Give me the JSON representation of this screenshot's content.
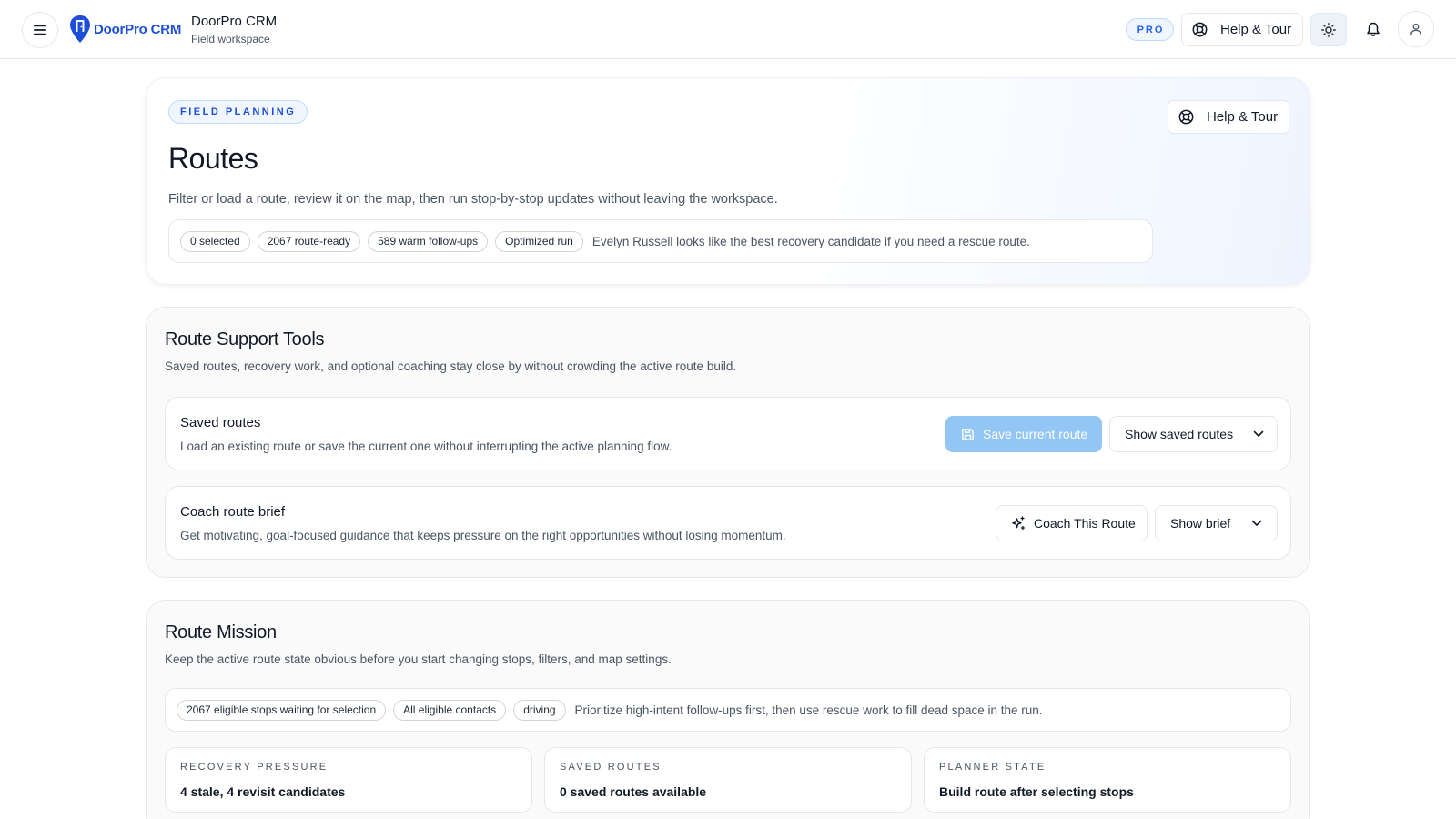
{
  "app": {
    "logo_text": "DoorPro CRM",
    "title": "DoorPro CRM",
    "subtitle": "Field workspace"
  },
  "topbar": {
    "plan_badge": "PRO",
    "help_label": "Help & Tour",
    "icons": [
      "menu-icon",
      "sun-icon",
      "bell-icon",
      "user-icon",
      "lifebuoy-icon"
    ]
  },
  "hero": {
    "eyebrow": "FIELD PLANNING",
    "title": "Routes",
    "description": "Filter or load a route, review it on the map, then run stop-by-stop updates without leaving the workspace.",
    "help_label": "Help & Tour",
    "chips": [
      "0 selected",
      "2067 route-ready",
      "589 warm follow-ups",
      "Optimized run"
    ],
    "insight": "Evelyn Russell looks like the best recovery candidate if you need a rescue route."
  },
  "support": {
    "title": "Route Support Tools",
    "description": "Saved routes, recovery work, and optional coaching stay close by without crowding the active route build.",
    "saved": {
      "title": "Saved routes",
      "description": "Load an existing route or save the current one without interrupting the active planning flow.",
      "save_label": "Save current route",
      "show_label": "Show saved routes"
    },
    "coach": {
      "title": "Coach route brief",
      "description": "Get motivating, goal-focused guidance that keeps pressure on the right opportunities without losing momentum.",
      "coach_label": "Coach This Route",
      "show_label": "Show brief"
    }
  },
  "mission": {
    "title": "Route Mission",
    "description": "Keep the active route state obvious before you start changing stops, filters, and map settings.",
    "chips": [
      "2067 eligible stops waiting for selection",
      "All eligible contacts",
      "driving"
    ],
    "guidance": "Prioritize high-intent follow-ups first, then use rescue work to fill dead space in the run.",
    "stats": [
      {
        "label": "RECOVERY PRESSURE",
        "value": "4 stale, 4 revisit candidates"
      },
      {
        "label": "SAVED ROUTES",
        "value": "0 saved routes available"
      },
      {
        "label": "PLANNER STATE",
        "value": "Build route after selecting stops"
      }
    ]
  },
  "colors": {
    "accent": "#2563eb",
    "save_button_disabled": "#93c5f5"
  }
}
